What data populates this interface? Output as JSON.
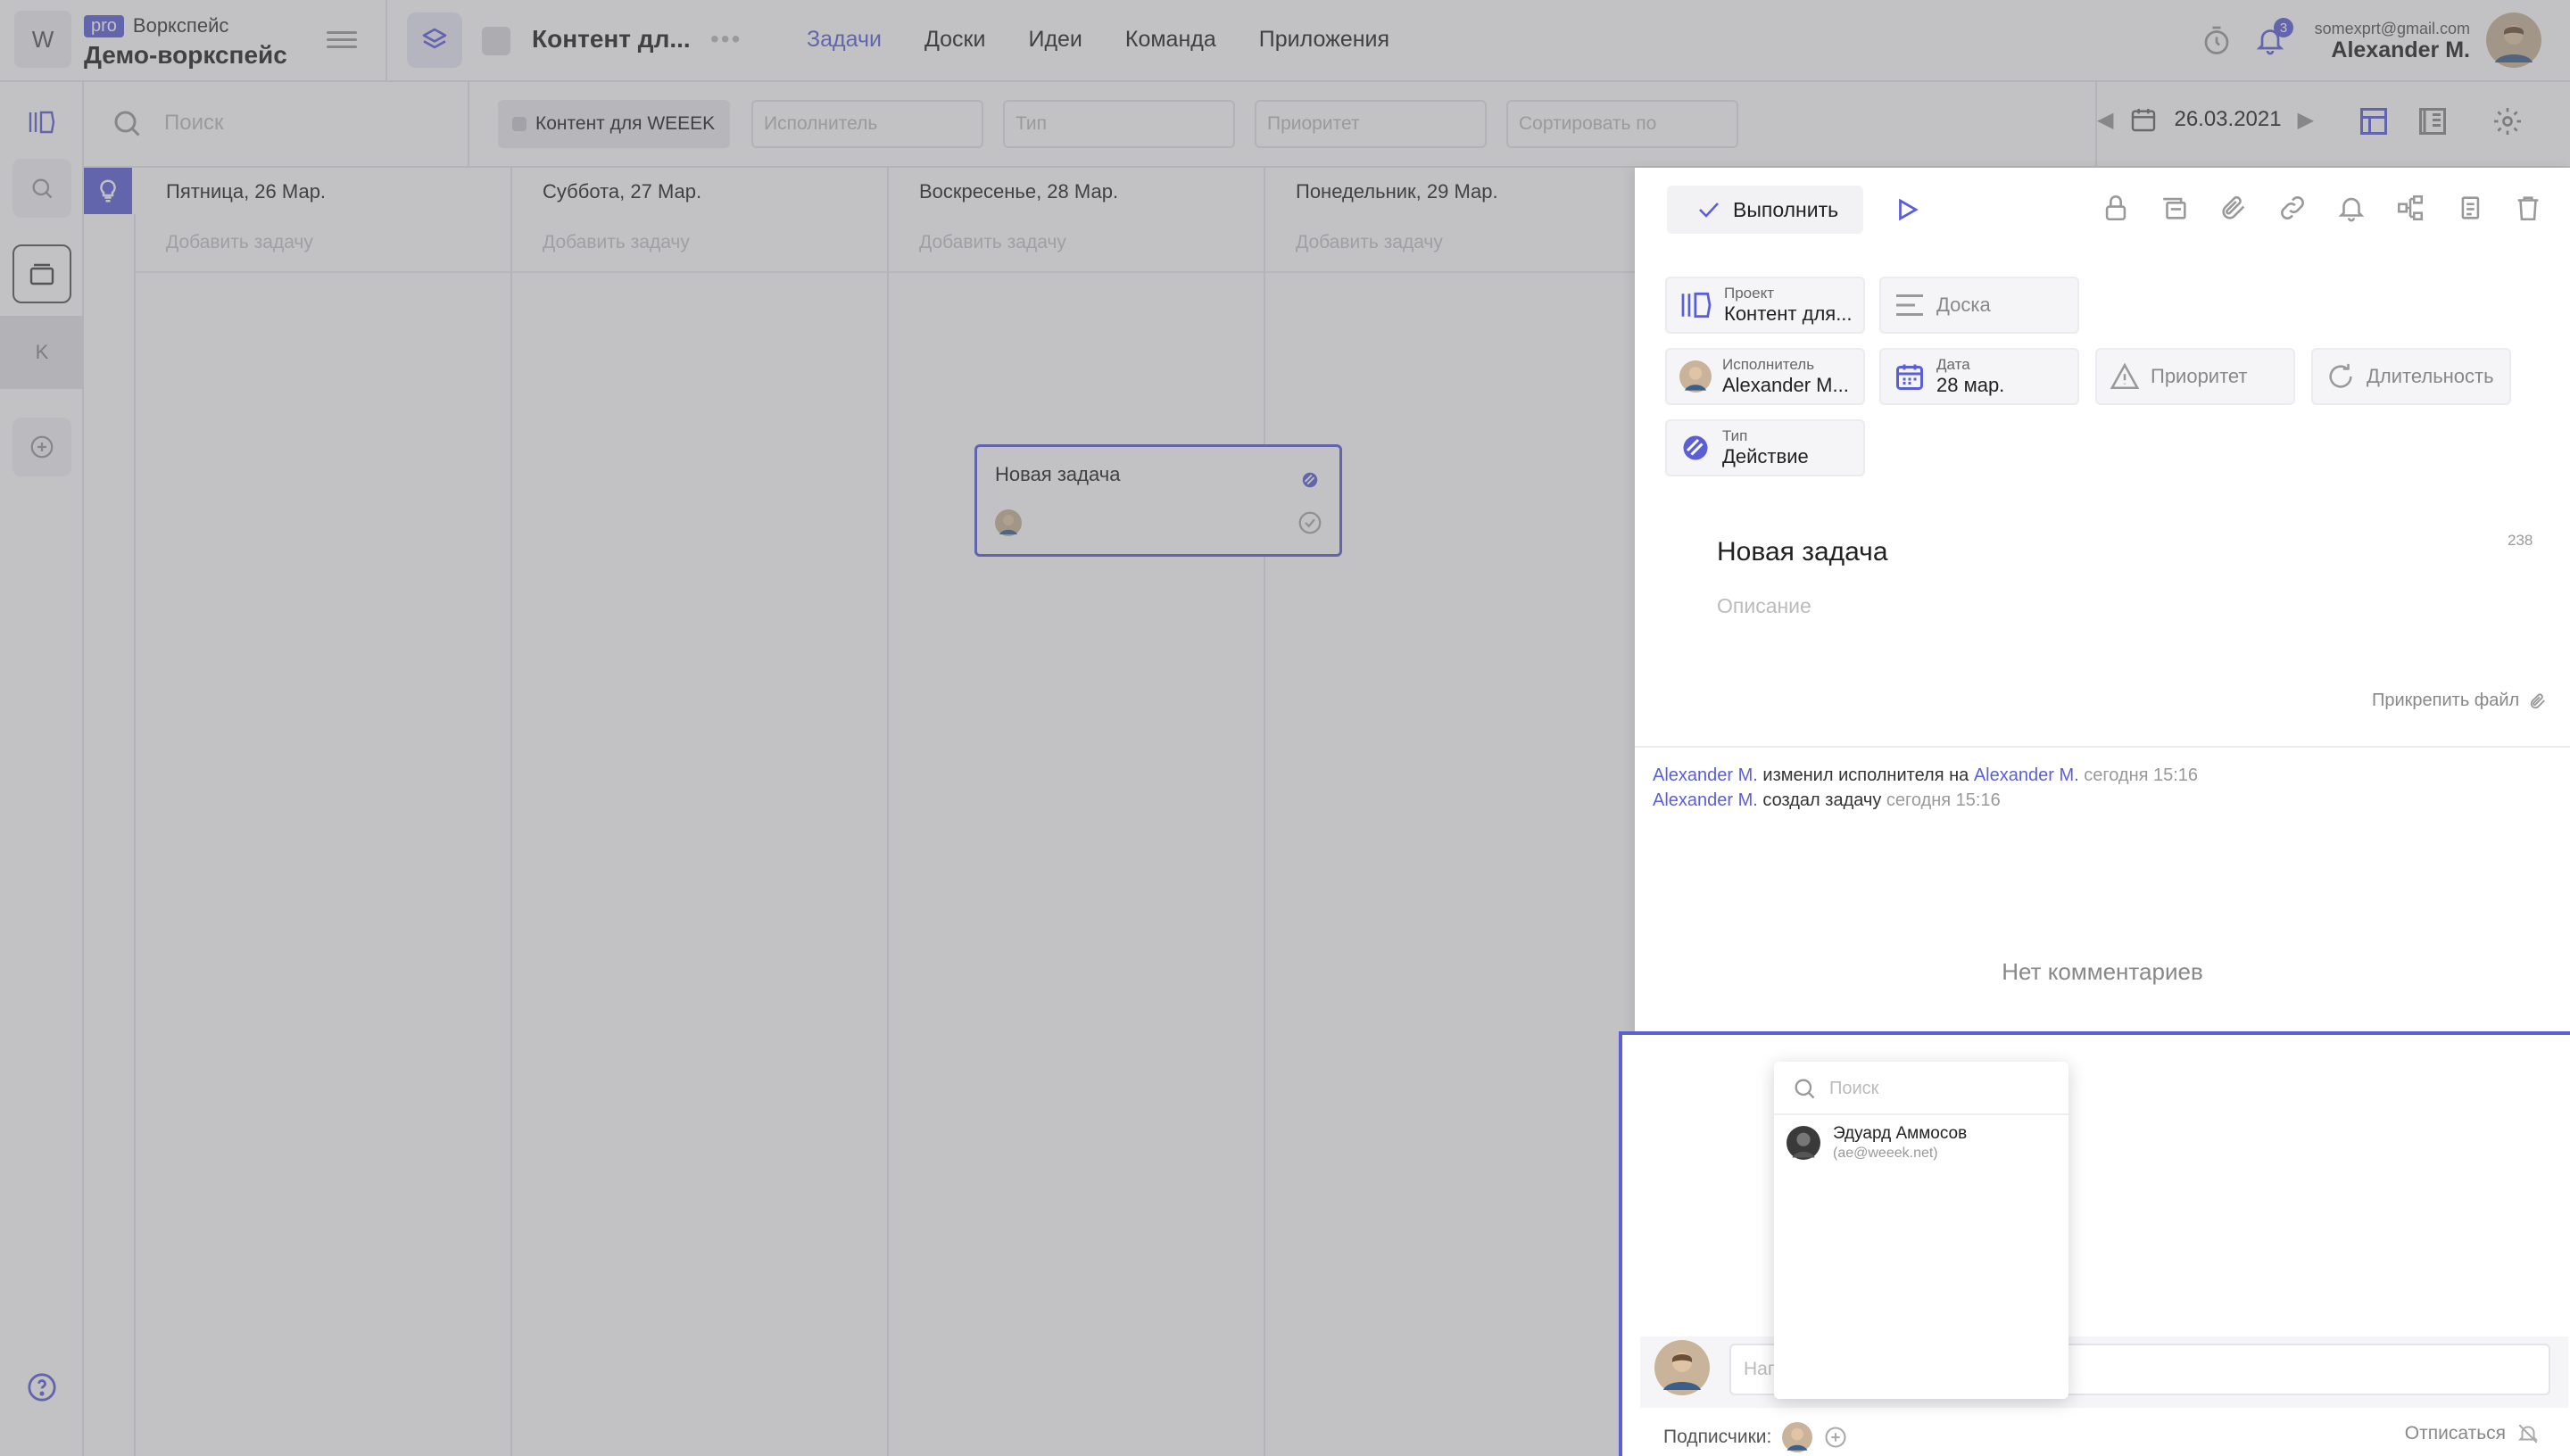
{
  "topbar": {
    "logo_letter": "W",
    "pro_badge": "pro",
    "workspace_label": "Воркспейс",
    "workspace_name": "Демо-воркспейс",
    "project_title": "Контент дл...",
    "nav": [
      "Задачи",
      "Доски",
      "Идеи",
      "Команда",
      "Приложения"
    ],
    "active_nav": "Задачи",
    "notif_count": "3",
    "user_email": "somexprt@gmail.com",
    "user_name": "Alexander M."
  },
  "sidebar": {
    "k_letter": "K"
  },
  "filters": {
    "search_placeholder": "Поиск",
    "project_chip": "Контент для WEEEK",
    "executor_placeholder": "Исполнитель",
    "type_placeholder": "Тип",
    "priority_placeholder": "Приоритет",
    "sort_placeholder": "Сортировать по",
    "date": "26.03.2021"
  },
  "board": {
    "days": [
      {
        "label": "Пятница, 26 Мар.",
        "add": "Добавить задачу"
      },
      {
        "label": "Суббота, 27 Мар.",
        "add": "Добавить задачу"
      },
      {
        "label": "Воскресенье, 28 Мар.",
        "add": "Добавить задачу"
      },
      {
        "label": "Понедельник, 29 Мар.",
        "add": "Добавить задачу"
      }
    ],
    "task_card_title": "Новая задача"
  },
  "panel": {
    "done_label": "Выполнить",
    "project_label": "Проект",
    "project_value": "Контент для...",
    "board_placeholder": "Доска",
    "executor_label": "Исполнитель",
    "executor_value": "Alexander M...",
    "date_label": "Дата",
    "date_value": "28 мар.",
    "priority_placeholder": "Приоритет",
    "duration_placeholder": "Длительность",
    "type_label": "Тип",
    "type_value": "Действие",
    "task_title": "Новая задача",
    "task_id": "238",
    "description_placeholder": "Описание",
    "attach_label": "Прикрепить файл",
    "log": [
      {
        "user": "Alexander M.",
        "action": "изменил исполнителя на",
        "target": "Alexander M.",
        "time": "сегодня 15:16"
      },
      {
        "user": "Alexander M.",
        "action": "создал задачу",
        "target": "",
        "time": "сегодня 15:16"
      }
    ],
    "no_comments": "Нет комментариев",
    "comment_placeholder": "Напи",
    "subscribers_label": "Подписчики:",
    "unsubscribe_label": "Отписаться"
  },
  "mention": {
    "search_placeholder": "Поиск",
    "user_name": "Эдуард Аммосов",
    "user_email": "(ae@weeek.net)"
  },
  "colors": {
    "accent": "#5b5fd6",
    "overlay": "#6e6e73"
  }
}
